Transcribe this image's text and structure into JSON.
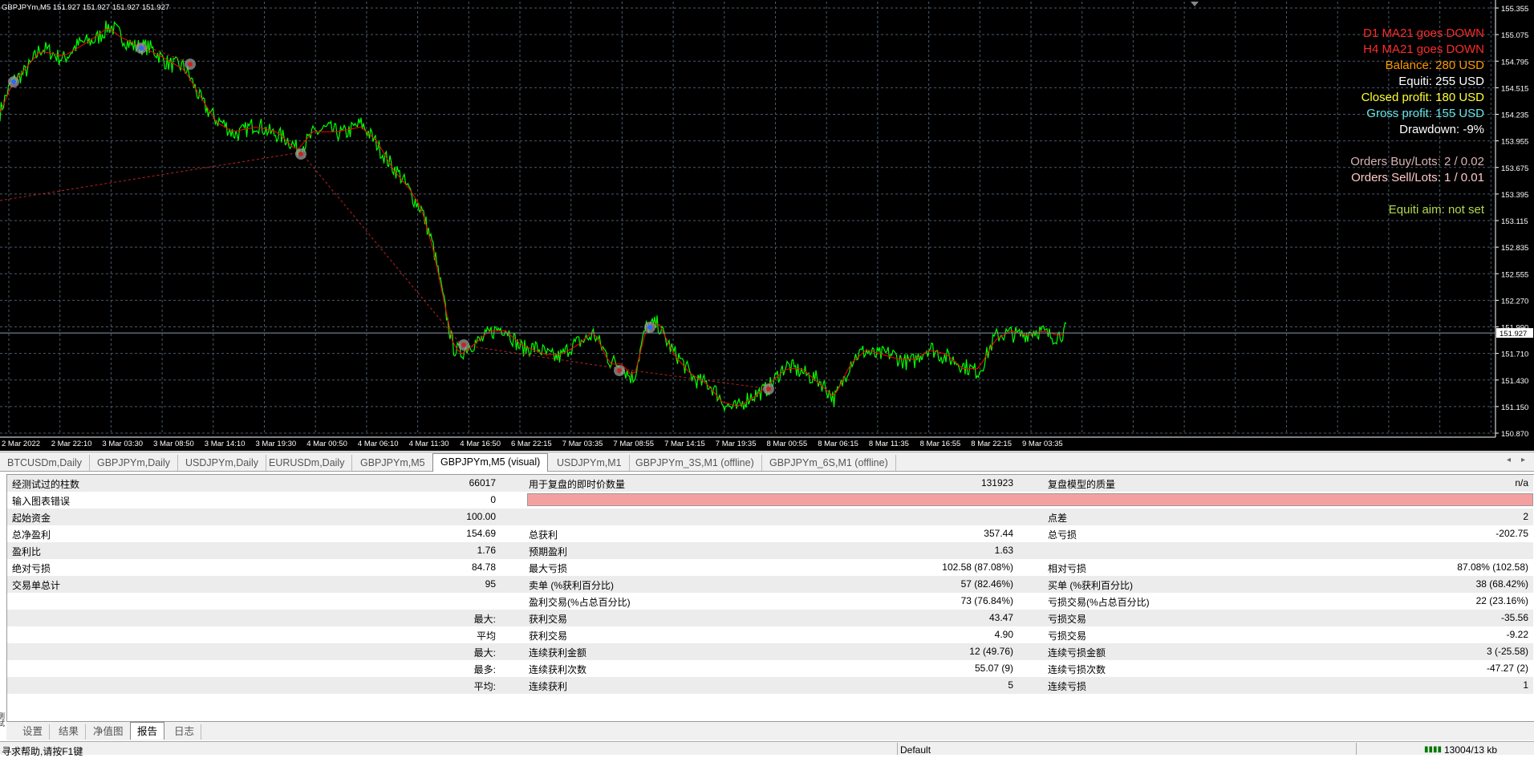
{
  "chart": {
    "symbol_header": "GBPJPYm,M5  151.927 151.927 151.927 151.927",
    "current_price": "151.927",
    "price_ticks": [
      "155.355",
      "155.075",
      "154.795",
      "154.515",
      "154.235",
      "153.955",
      "153.675",
      "153.395",
      "153.115",
      "152.835",
      "152.555",
      "152.270",
      "151.990",
      "151.710",
      "151.430",
      "151.150",
      "150.870"
    ],
    "time_ticks": [
      "2 Mar 2022",
      "2 Mar 22:10",
      "3 Mar 03:30",
      "3 Mar 08:50",
      "3 Mar 14:10",
      "3 Mar 19:30",
      "4 Mar 00:50",
      "4 Mar 06:10",
      "4 Mar 11:30",
      "4 Mar 16:50",
      "6 Mar 22:15",
      "7 Mar 03:35",
      "7 Mar 08:55",
      "7 Mar 14:15",
      "7 Mar 19:35",
      "8 Mar 00:55",
      "8 Mar 06:15",
      "8 Mar 11:35",
      "8 Mar 16:55",
      "8 Mar 22:15",
      "9 Mar 03:35"
    ],
    "info_lines": [
      {
        "text": "D1 MA21 goes DOWN",
        "color": "#ff2a2a"
      },
      {
        "text": "H4 MA21 goes DOWN",
        "color": "#ff2a2a"
      },
      {
        "text": "Balance: 280 USD",
        "color": "#ff9900"
      },
      {
        "text": "Equiti: 255 USD",
        "color": "#ffffff"
      },
      {
        "text": "Closed profit: 180 USD",
        "color": "#ffff33"
      },
      {
        "text": "Gross profit: 155 USD",
        "color": "#66e6e6"
      },
      {
        "text": "Drawdown: -9%",
        "color": "#ffffff"
      },
      {
        "text": "",
        "color": "#ffffff"
      },
      {
        "text": "Orders Buy/Lots: 2 / 0.02",
        "color": "#d9b3b3"
      },
      {
        "text": "Orders Sell/Lots: 1 / 0.01",
        "color": "#ffc8c8"
      },
      {
        "text": "",
        "color": "#ffffff"
      },
      {
        "text": "Equiti aim: not set",
        "color": "#b3d94d"
      }
    ],
    "colors": {
      "price_line": "#00ff00",
      "ma_line": "#ff0000",
      "grid": "#4a5a6a",
      "axis_text": "#ffffff"
    }
  },
  "tabs": [
    "BTCUSDm,Daily",
    "GBPJPYm,Daily",
    "USDJPYm,Daily",
    "EURUSDm,Daily",
    "GBPJPYm,M5",
    "GBPJPYm,M5 (visual)",
    "USDJPYm,M1",
    "GBPJPYm_3S,M1 (offline)",
    "GBPJPYm_6S,M1 (offline)"
  ],
  "active_tab": 5,
  "report": {
    "rows": [
      {
        "c1": "经测试过的柱数",
        "v1": "66017",
        "c2": "用于复盘的即时价数量",
        "v2": "131923",
        "c3": "复盘模型的质量",
        "v3": "n/a"
      },
      {
        "c1": "输入图表错误",
        "v1": "0",
        "c2": "",
        "v2": "",
        "c3": "",
        "v3": ""
      },
      {
        "c1": "起始资金",
        "v1": "100.00",
        "c2": "",
        "v2": "",
        "c3": "点差",
        "v3": "2"
      },
      {
        "c1": "总净盈利",
        "v1": "154.69",
        "c2": "总获利",
        "v2": "357.44",
        "c3": "总亏损",
        "v3": "-202.75"
      },
      {
        "c1": "盈利比",
        "v1": "1.76",
        "c2": "预期盈利",
        "v2": "1.63",
        "c3": "",
        "v3": ""
      },
      {
        "c1": "绝对亏损",
        "v1": "84.78",
        "c2": "最大亏损",
        "v2": "102.58 (87.08%)",
        "c3": "相对亏损",
        "v3": "87.08% (102.58)"
      },
      {
        "c1": "交易单总计",
        "v1": "95",
        "c2": "卖单 (%获利百分比)",
        "v2": "57 (82.46%)",
        "c3": "买单 (%获利百分比)",
        "v3": "38 (68.42%)"
      },
      {
        "c1": "",
        "v1": "",
        "c2": "盈利交易(%占总百分比)",
        "v2": "73 (76.84%)",
        "c3": "亏损交易(%占总百分比)",
        "v3": "22 (23.16%)"
      },
      {
        "c1": "",
        "v1": "最大:",
        "c2": "获利交易",
        "v2": "43.47",
        "c3": "亏损交易",
        "v3": "-35.56"
      },
      {
        "c1": "",
        "v1": "平均",
        "c2": "获利交易",
        "v2": "4.90",
        "c3": "亏损交易",
        "v3": "-9.22"
      },
      {
        "c1": "",
        "v1": "最大:",
        "c2": "连续获利金额",
        "v2": "12 (49.76)",
        "c3": "连续亏损金额",
        "v3": "3 (-25.58)"
      },
      {
        "c1": "",
        "v1": "最多:",
        "c2": "连续获利次数",
        "v2": "55.07 (9)",
        "c3": "连续亏损次数",
        "v3": "-47.27 (2)"
      },
      {
        "c1": "",
        "v1": "平均:",
        "c2": "连续获利",
        "v2": "5",
        "c3": "连续亏损",
        "v3": "1"
      }
    ]
  },
  "bottom_tabs": [
    "设置",
    "结果",
    "净值图",
    "报告",
    "日志"
  ],
  "active_bottom_tab": 3,
  "sidebar_text": "测试",
  "status": {
    "help": "寻求帮助,请按F1键",
    "profile": "Default",
    "traffic": "13004/13 kb"
  }
}
